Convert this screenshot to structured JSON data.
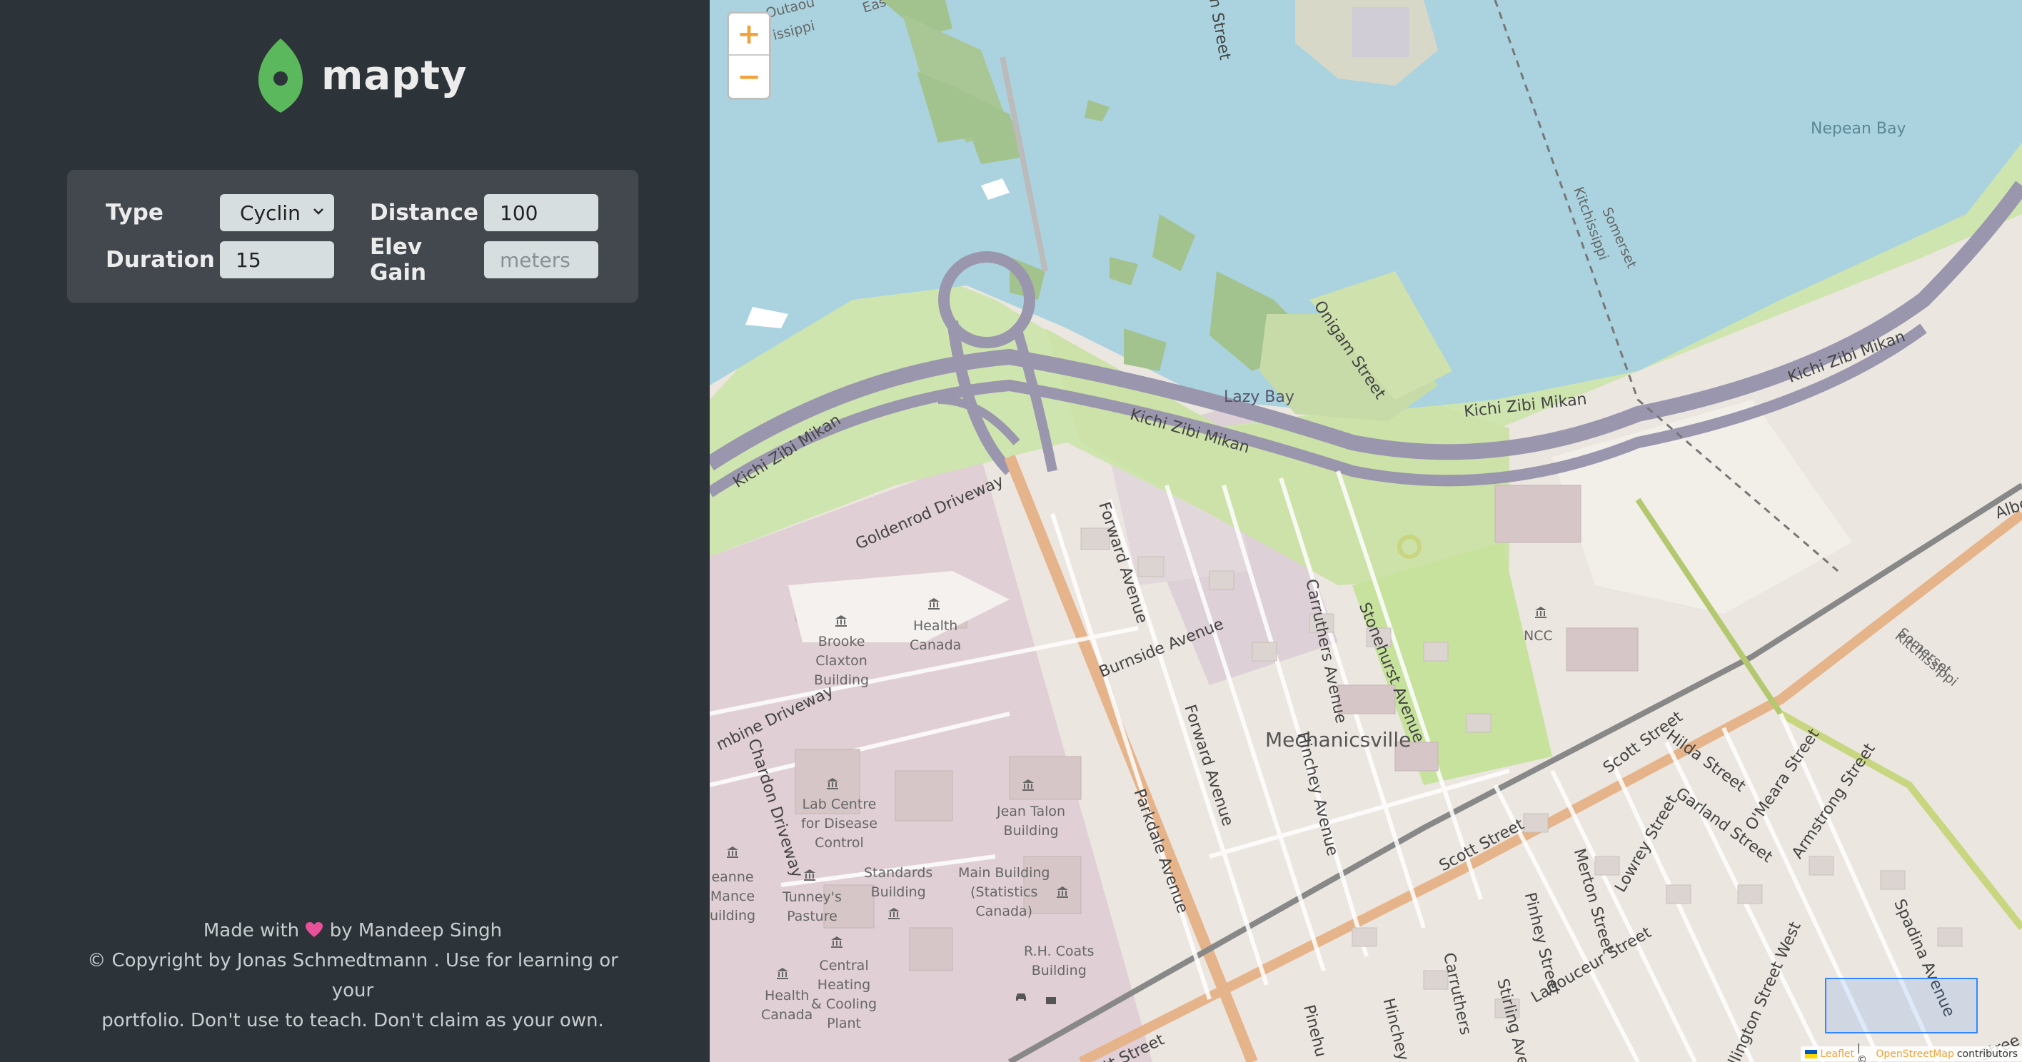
{
  "app": {
    "name": "mapty"
  },
  "form": {
    "type_label": "Type",
    "type_value": "Cyclin",
    "distance_label": "Distance",
    "distance_value": "100",
    "duration_label": "Duration",
    "duration_value": "15",
    "elev_label": "Elev Gain",
    "elev_placeholder": "meters"
  },
  "footer": {
    "line1_prefix": "Made with",
    "line1_suffix": "by Mandeep Singh",
    "line2": "© Copyright by Jonas Schmedtmann . Use for learning or your",
    "line3": "portfolio. Don't use to teach. Don't claim as your own."
  },
  "map": {
    "zoom_in": "+",
    "zoom_out": "−",
    "labels": {
      "nepean_bay": "Nepean Bay",
      "lazy_bay": "Lazy Bay",
      "kichi1": "Kichi Zibi Mikan",
      "kichi2": "Kichi Zibi Mikan",
      "kichi3": "Kichi Zibi Mikan",
      "kichi4": "Kichi Zibi Mikan",
      "goldenrod": "Goldenrod Driveway",
      "forward1": "Forward Avenue",
      "forward2": "Forward Avenue",
      "burnside": "Burnside Avenue",
      "carruthers1": "Carruthers Avenue",
      "carruthers2": "Carruthers",
      "stonehurst": "Stonehurst Avenue",
      "mechanicsville": "Mechanicsville",
      "hinchey1": "Hinchey Avenue",
      "hinchey2": "Hinchey",
      "parkdale": "Parkdale Avenue",
      "onigam": "Onigam Street",
      "kitchissippi1": "Kitchissippi",
      "kitchissippi2": "Kitchissippi",
      "somerset1": "Somerset",
      "somerset2": "Somerset",
      "scott1": "Scott Street",
      "scott2": "Scott Street",
      "scott3": "ott Street",
      "hilda": "Hilda Street",
      "garland": "Garland Street",
      "omeara": "O'Meara Street",
      "armstrong": "Armstrong Street",
      "lowrey": "Lowrey Street",
      "merton": "Merton Street",
      "pinhey": "Pinhey Street",
      "pinehu": "Pinehu",
      "ladouceur": "Ladouceur Street",
      "stirling": "Stirling Ave",
      "spadina": "Spadina Avenue",
      "wellington": "ellington Street West",
      "chardon": "Chardon Driveway",
      "tumbine": "mbine Driveway",
      "street_top": "n Street",
      "ncc": "NCC",
      "health_canada1": "Health\nCanada",
      "brooke": "Brooke\nClaxton\nBuilding",
      "lab_centre": "Lab Centre\nfor Disease\nControl",
      "jean_talon": "Jean Talon\nBuilding",
      "standards": "Standards\nBuilding",
      "main_building": "Main Building\n(Statistics\nCanada)",
      "rh_coats": "R.H. Coats\nBuilding",
      "tunneys": "Tunney's\nPasture",
      "central_heating": "Central\nHeating\n& Cooling\nPlant",
      "health_canada2": "Health\nCanada",
      "jeanne_mance": "eanne\nMance\nuilding",
      "albe": "Albe",
      "stre": "Stree",
      "ssippi": "issippi",
      "outaouais": "Outaou",
      "eas": "Eas"
    },
    "attribution": {
      "leaflet": "Leaflet",
      "sep": "| ©",
      "osm": "OpenStreetMap",
      "contributors": "contributors"
    }
  },
  "colors": {
    "sidebar_bg": "#2d3439",
    "form_bg": "#42484d",
    "brand_green": "#5cb85c",
    "accent_orange": "#f0a33a",
    "water": "#aad3df",
    "park": "#c8e0a8",
    "highway": "#9a96ad"
  }
}
